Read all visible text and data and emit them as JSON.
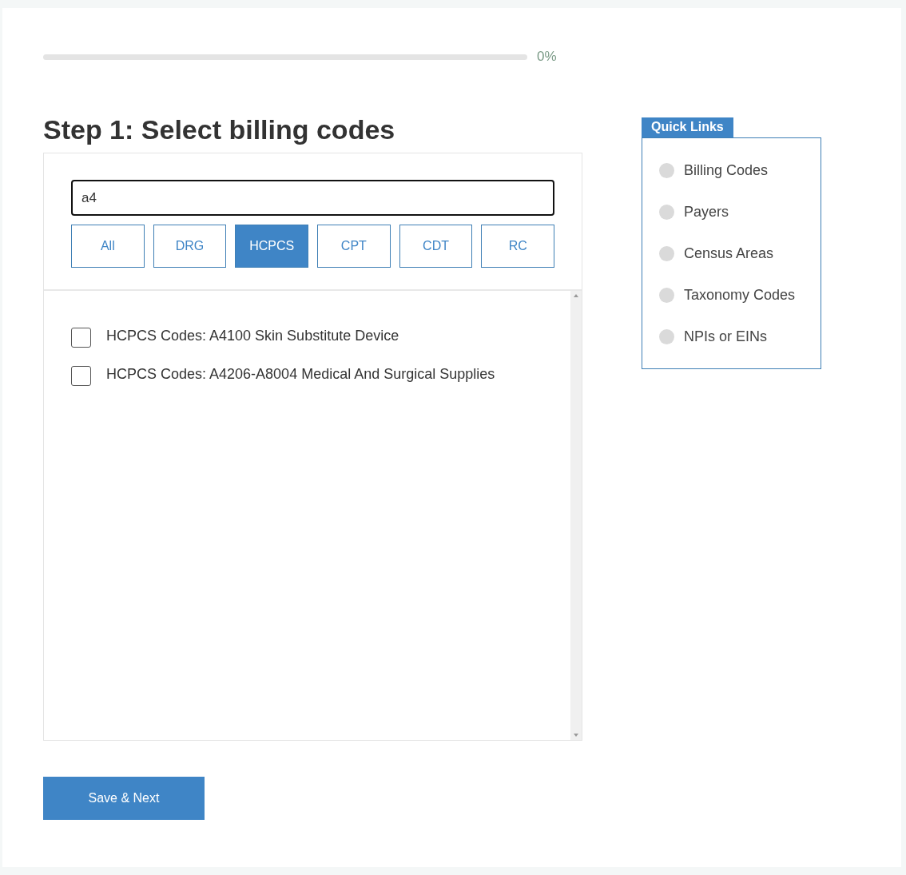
{
  "progress": {
    "level": 0,
    "reading": "0%"
  },
  "heading": "Step 1: Select billing codes",
  "search": {
    "value": "a4"
  },
  "filters": [
    {
      "label": "All",
      "selected": false
    },
    {
      "label": "DRG",
      "selected": false
    },
    {
      "label": "HCPCS",
      "selected": true
    },
    {
      "label": "CPT",
      "selected": false
    },
    {
      "label": "CDT",
      "selected": false
    },
    {
      "label": "RC",
      "selected": false
    }
  ],
  "results": [
    {
      "label": "HCPCS Codes: A4100 Skin Substitute Device",
      "checked": false
    },
    {
      "label": "HCPCS Codes: A4206-A8004 Medical And Surgical Supplies",
      "checked": false
    }
  ],
  "quick_links": {
    "title": "Quick Links",
    "items": [
      "Billing Codes",
      "Payers",
      "Census Areas",
      "Taxonomy Codes",
      "NPIs or EINs"
    ]
  },
  "save_button": "Save & Next"
}
